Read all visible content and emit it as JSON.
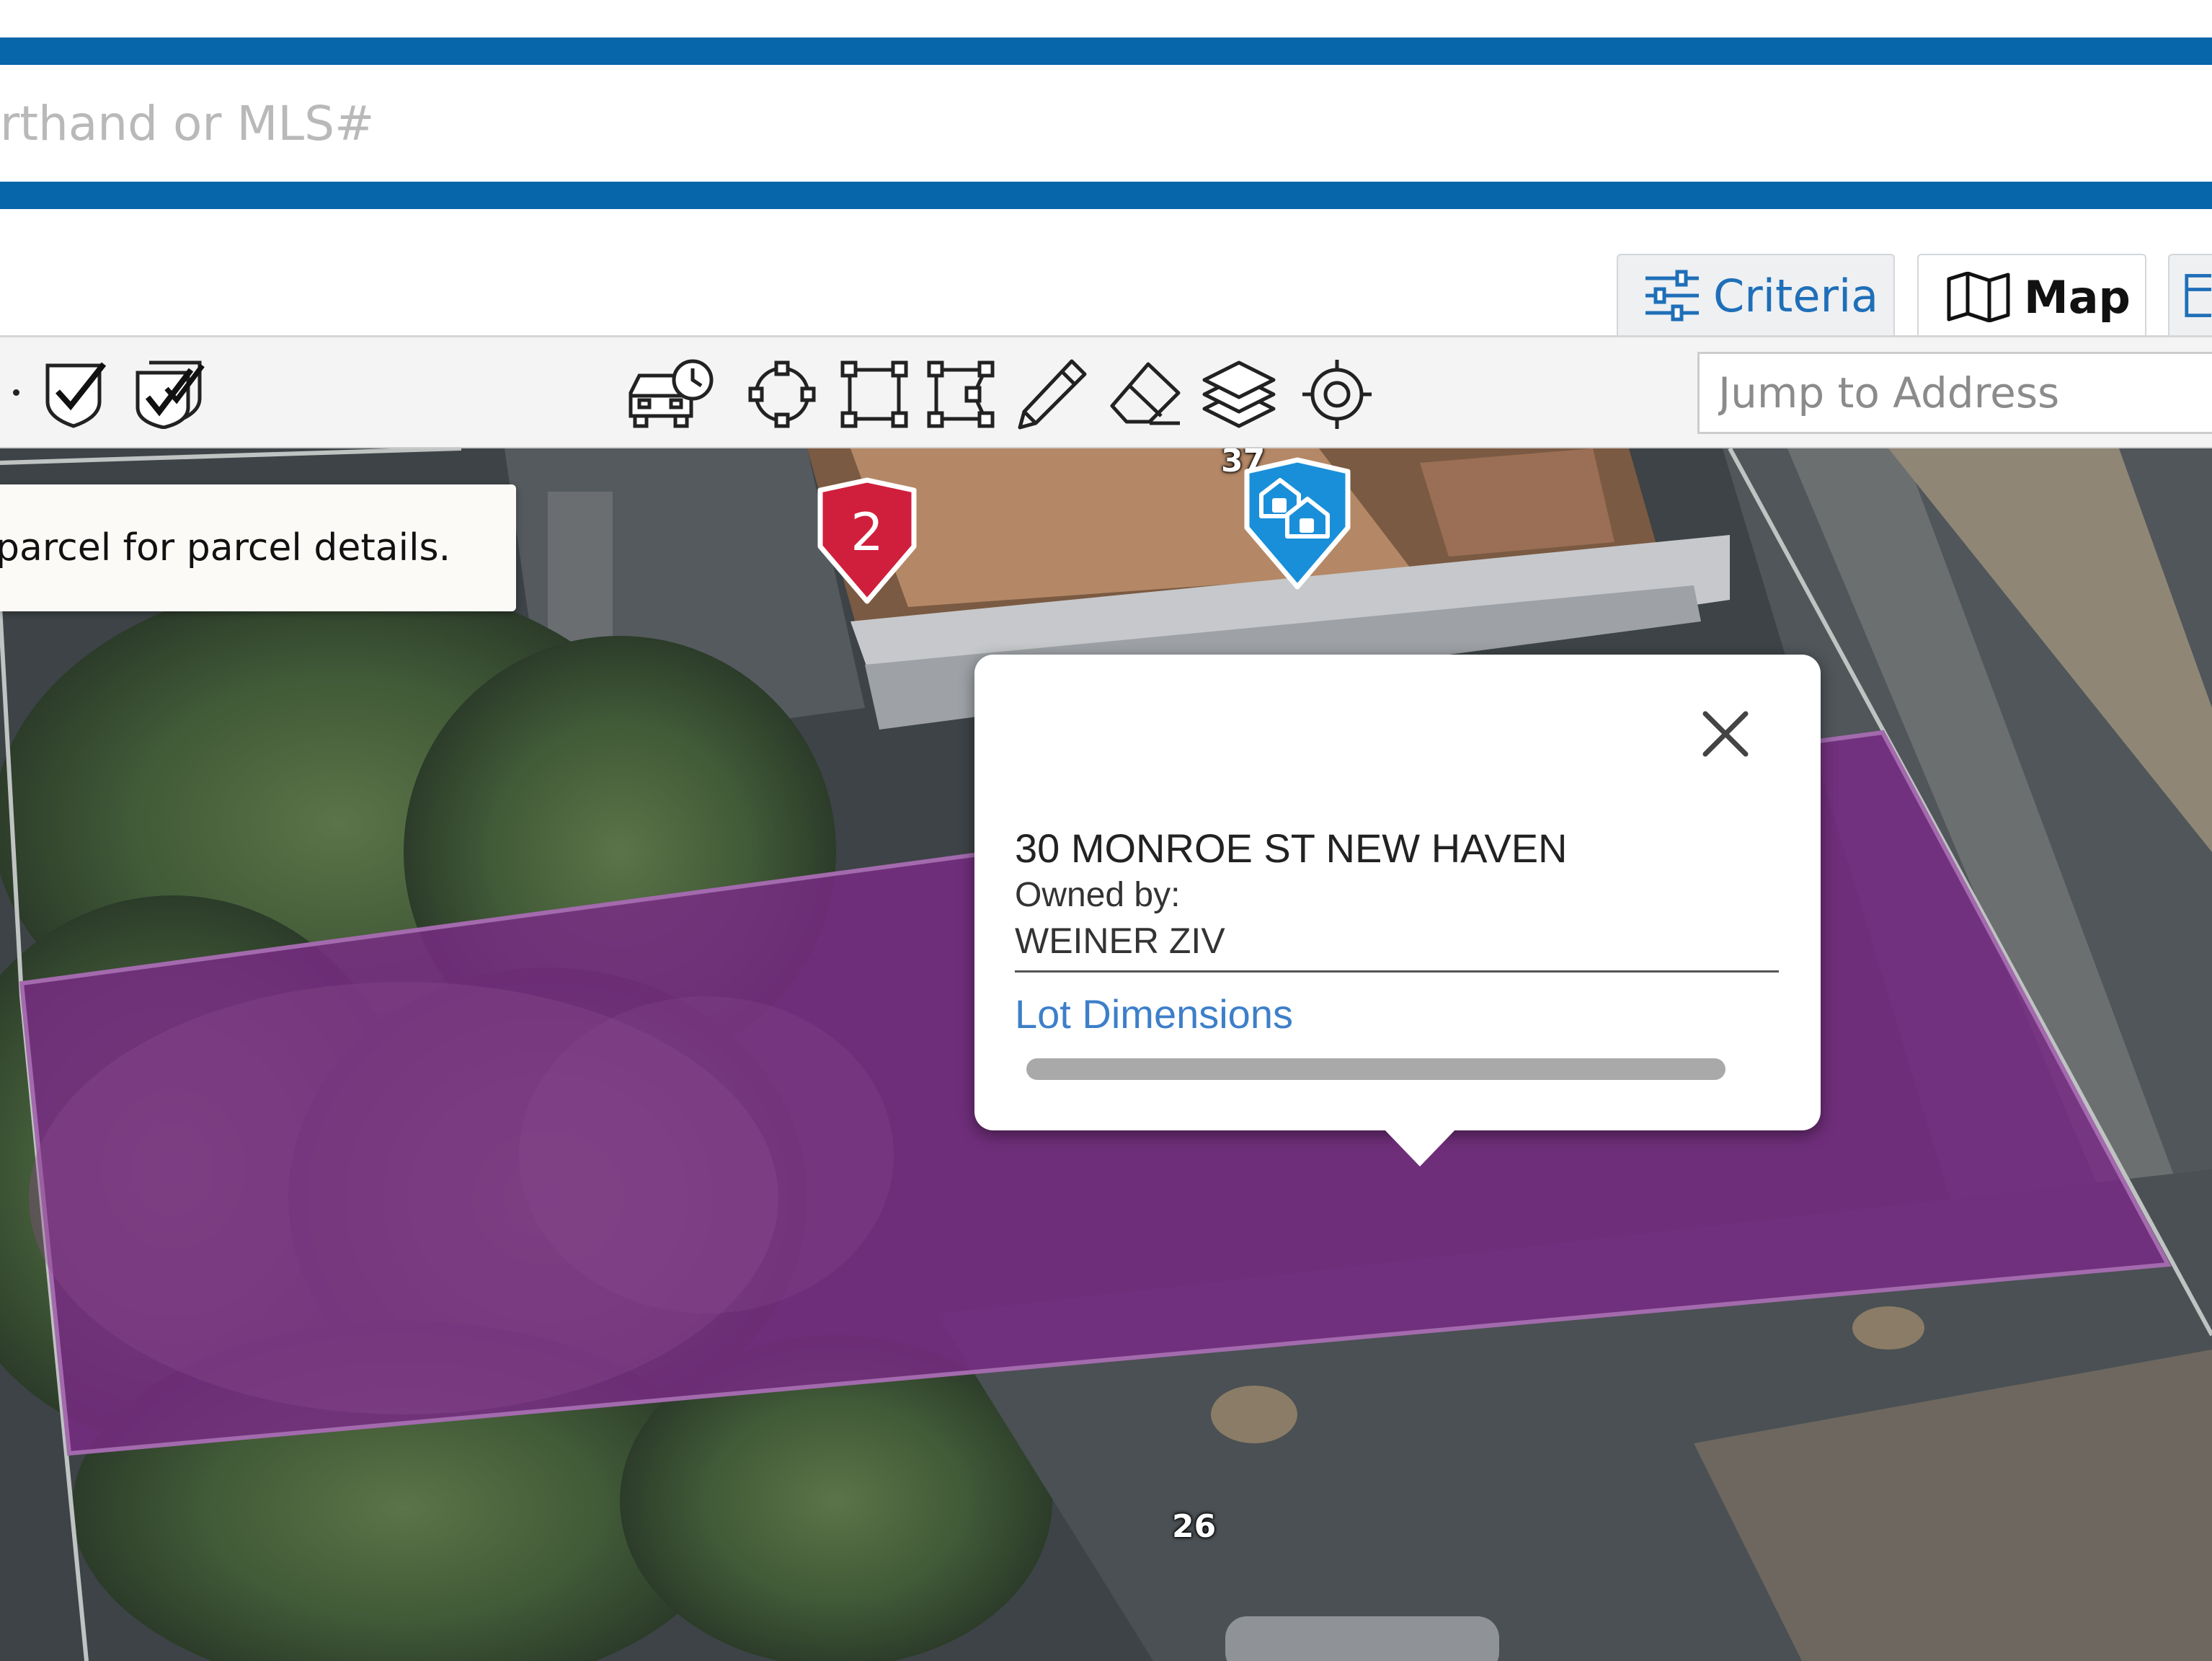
{
  "search": {
    "placeholder": "rthand or MLS#"
  },
  "tabs": [
    {
      "label": "Criteria",
      "icon": "sliders-icon",
      "selected": false
    },
    {
      "label": "Map",
      "icon": "map-icon",
      "selected": true
    }
  ],
  "toolbar": {
    "tools": [
      "checkbox-checked-icon",
      "checkbox-multi-checked-icon",
      "drive-time-car-icon",
      "draw-circle-icon",
      "draw-rectangle-icon",
      "draw-polygon-icon",
      "pencil-icon",
      "eraser-icon",
      "layers-icon",
      "locate-target-icon"
    ],
    "jump_placeholder": "Jump to Address"
  },
  "map": {
    "tooltip": "parcel for parcel details.",
    "house_numbers": [
      "37",
      "26"
    ],
    "pins": [
      {
        "type": "numbered",
        "label": "2",
        "color": "#d01f3c"
      },
      {
        "type": "house-cluster",
        "color": "#1a8fd9"
      }
    ],
    "parcel_color": "#7a2a86"
  },
  "popup": {
    "address": "30 MONROE ST NEW HAVEN",
    "owned_by_label": "Owned by:",
    "owner": "WEINER ZIV",
    "link": "Lot Dimensions",
    "progress_percent": 100
  },
  "colors": {
    "brand_blue": "#0765a9",
    "link_blue": "#3d7fc9",
    "tab_blue": "#1f6fb8"
  }
}
